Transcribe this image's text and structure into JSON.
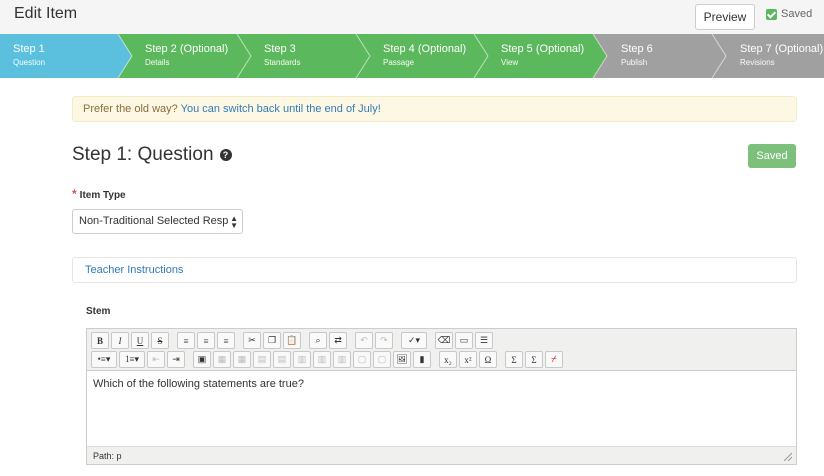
{
  "header": {
    "title": "Edit Item",
    "preview_label": "Preview",
    "saved_label": "Saved"
  },
  "wizard": {
    "colors": {
      "active": "#5bc0de",
      "complete": "#5cb85c",
      "future": "#a0a0a0"
    },
    "steps": [
      {
        "label": "Step 1",
        "sub": "Question",
        "state": "active"
      },
      {
        "label": "Step 2  (Optional)",
        "sub": "Details",
        "state": "complete"
      },
      {
        "label": "Step 3",
        "sub": "Standards",
        "state": "complete"
      },
      {
        "label": "Step 4  (Optional)",
        "sub": "Passage",
        "state": "complete"
      },
      {
        "label": "Step 5  (Optional)",
        "sub": "View",
        "state": "complete"
      },
      {
        "label": "Step 6",
        "sub": "Publish",
        "state": "future"
      },
      {
        "label": "Step 7  (Optional)",
        "sub": "Revisions",
        "state": "future"
      }
    ]
  },
  "notice": {
    "text": "Prefer the old way?",
    "link": "You can switch back until the end of July!"
  },
  "main": {
    "heading": "Step 1: Question",
    "help_icon": "question-circle-icon",
    "saved_button": "Saved",
    "item_type_required": "*",
    "item_type_label": "Item Type",
    "item_type_value": "Non-Traditional Selected Respc",
    "teacher_instructions": "Teacher Instructions",
    "stem_label": "Stem"
  },
  "editor": {
    "content": "Which of the following statements are true?",
    "path": "Path: p",
    "toolbar_row1": [
      "bold-icon",
      "italic-icon",
      "underline-icon",
      "strikethrough-icon",
      "align-left-icon",
      "align-center-icon",
      "align-right-icon",
      "cut-icon",
      "copy-icon",
      "paste-icon",
      "find-icon",
      "replace-icon",
      "undo-icon",
      "redo-icon",
      "spellcheck-icon",
      "eraser-icon",
      "insert-field-icon",
      "source-icon"
    ],
    "toolbar_row2": [
      "bullet-list-icon",
      "numbered-list-icon",
      "outdent-icon",
      "indent-icon",
      "image-icon",
      "table-icon",
      "table-props-icon",
      "row-icon",
      "delete-row-icon",
      "col-icon",
      "merge-icon",
      "split-icon",
      "cell-icon",
      "row-props-icon",
      "insert-image-icon",
      "media-icon",
      "subscript-icon",
      "superscript-icon",
      "special-char-icon",
      "sum-icon",
      "equation-icon",
      "graph-icon"
    ]
  }
}
